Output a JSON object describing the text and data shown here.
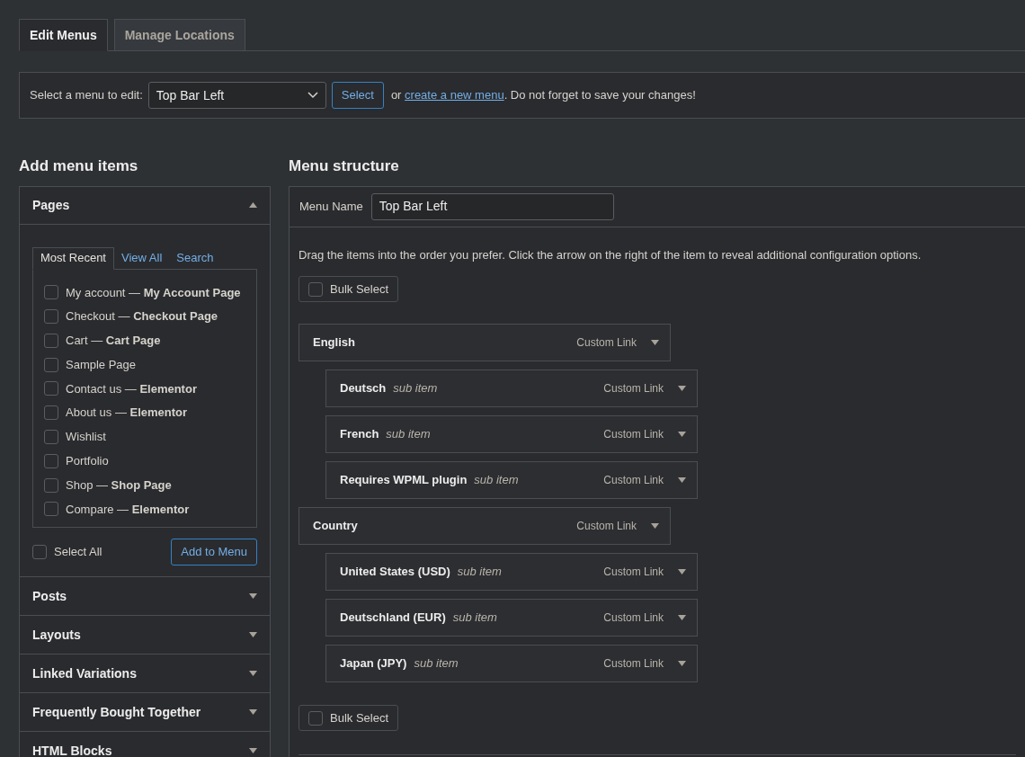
{
  "tabs": [
    {
      "label": "Edit Menus",
      "selected": true
    },
    {
      "label": "Manage Locations",
      "selected": false
    }
  ],
  "menu_select": {
    "label": "Select a menu to edit:",
    "value": "Top Bar Left",
    "button": "Select",
    "text_before": "or",
    "link": "create a new menu",
    "text_after": ". Do not forget to save your changes!"
  },
  "add_items": {
    "title": "Add menu items",
    "sections": [
      {
        "title": "Pages",
        "expanded": true,
        "tabs": [
          {
            "label": "Most Recent",
            "selected": true
          },
          {
            "label": "View All",
            "selected": false
          },
          {
            "label": "Search",
            "selected": false
          }
        ],
        "items": [
          {
            "label": "My account — **My Account Page**",
            "checked": false
          },
          {
            "label": "Checkout — **Checkout Page**",
            "checked": false
          },
          {
            "label": "Cart — **Cart Page**",
            "checked": false
          },
          {
            "label": "Sample Page",
            "checked": false
          },
          {
            "label": "Contact us — **Elementor**",
            "checked": false
          },
          {
            "label": "About us — **Elementor**",
            "checked": false
          },
          {
            "label": "Wishlist",
            "checked": false
          },
          {
            "label": "Portfolio",
            "checked": false
          },
          {
            "label": "Shop — **Shop Page**",
            "checked": false
          },
          {
            "label": "Compare — **Elementor**",
            "checked": false
          }
        ],
        "select_all": {
          "label": "Select All",
          "checked": false
        },
        "button": "Add to Menu"
      },
      {
        "title": "Posts",
        "expanded": false
      },
      {
        "title": "Layouts",
        "expanded": false
      },
      {
        "title": "Linked Variations",
        "expanded": false
      },
      {
        "title": "Frequently Bought Together",
        "expanded": false
      },
      {
        "title": "HTML Blocks",
        "expanded": false
      }
    ]
  },
  "menu_structure": {
    "title": "Menu structure",
    "name_label": "Menu Name",
    "name_value": "Top Bar Left",
    "instructions": "Drag the items into the order you prefer. Click the arrow on the right of the item to reveal additional configuration options.",
    "bulk_select_top": {
      "label": "Bulk Select",
      "checked": false
    },
    "items": [
      {
        "title": "English",
        "type": "Custom Link",
        "children": [
          {
            "title": "Deutsch",
            "note": "sub item",
            "type": "Custom Link"
          },
          {
            "title": "French",
            "note": "sub item",
            "type": "Custom Link"
          },
          {
            "title": "Requires WPML plugin",
            "note": "sub item",
            "type": "Custom Link"
          }
        ]
      },
      {
        "title": "Country",
        "type": "Custom Link",
        "children": [
          {
            "title": "United States (USD)",
            "note": "sub item",
            "type": "Custom Link"
          },
          {
            "title": "Deutschland (EUR)",
            "note": "sub item",
            "type": "Custom Link"
          },
          {
            "title": "Japan (JPY)",
            "note": "sub item",
            "type": "Custom Link"
          }
        ]
      }
    ],
    "bulk_select_bottom": {
      "label": "Bulk Select",
      "checked": false
    }
  }
}
